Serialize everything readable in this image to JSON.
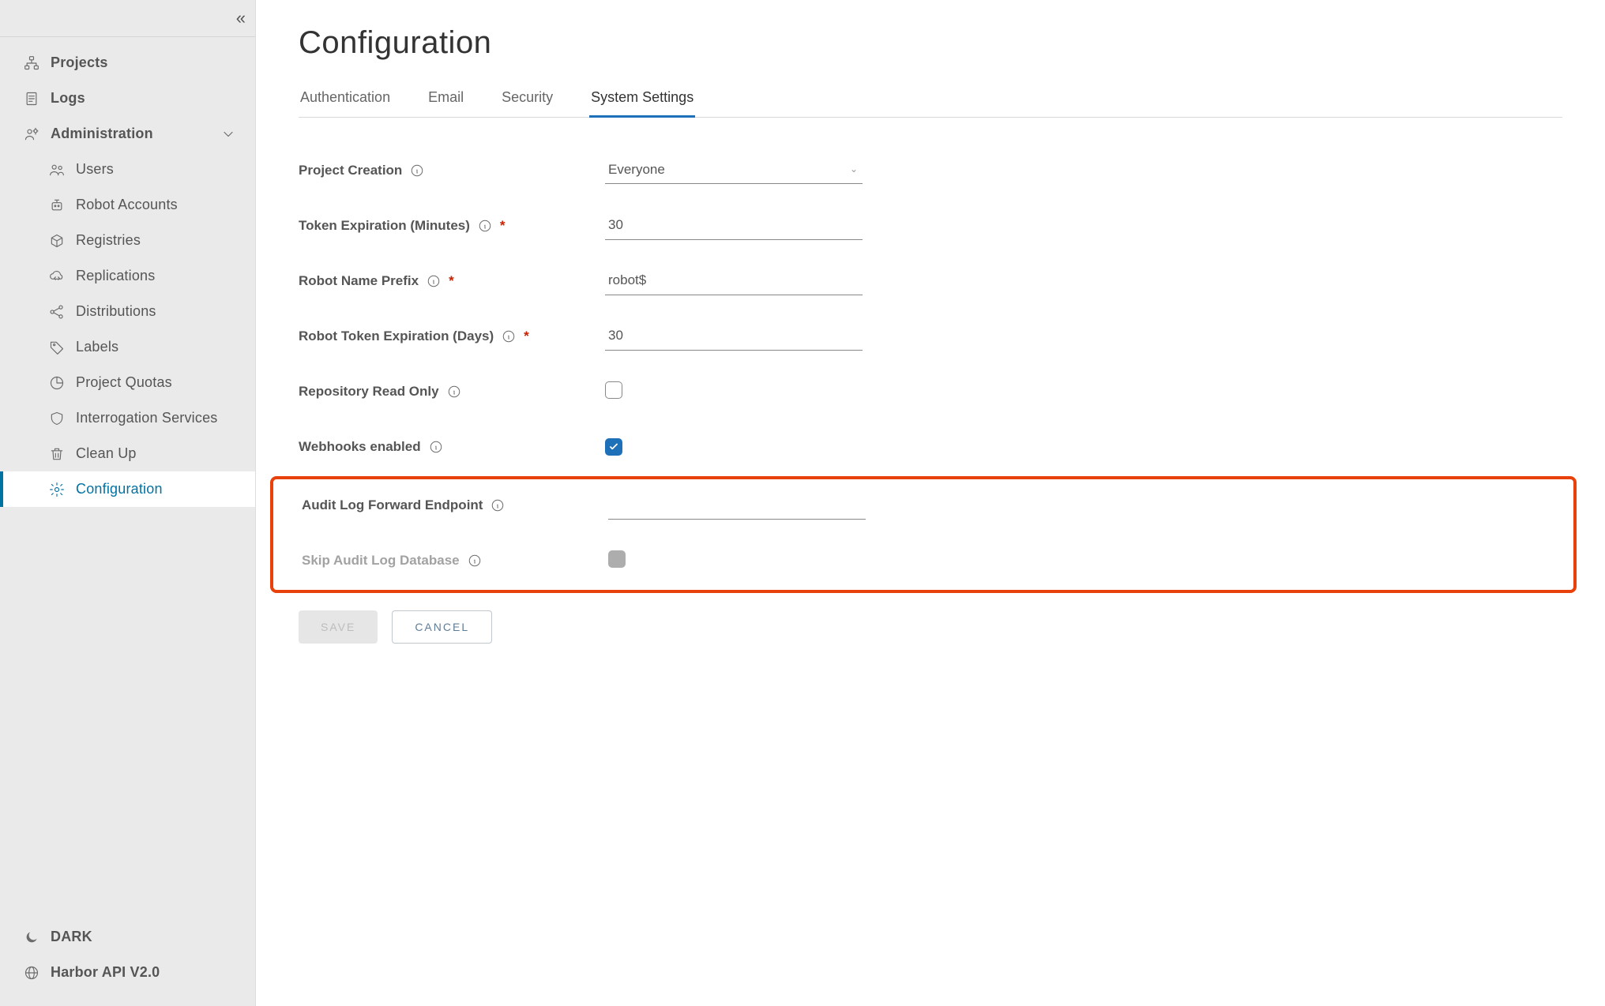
{
  "sidebar": {
    "collapse_glyph": "«",
    "items": [
      {
        "id": "projects",
        "label": "Projects",
        "icon": "sitemap"
      },
      {
        "id": "logs",
        "label": "Logs",
        "icon": "document"
      },
      {
        "id": "administration",
        "label": "Administration",
        "icon": "gear-user",
        "expanded": true,
        "children": [
          {
            "id": "users",
            "label": "Users",
            "icon": "users"
          },
          {
            "id": "robot-accounts",
            "label": "Robot Accounts",
            "icon": "robot"
          },
          {
            "id": "registries",
            "label": "Registries",
            "icon": "cube"
          },
          {
            "id": "replications",
            "label": "Replications",
            "icon": "cloud-sync"
          },
          {
            "id": "distributions",
            "label": "Distributions",
            "icon": "share"
          },
          {
            "id": "labels",
            "label": "Labels",
            "icon": "tag"
          },
          {
            "id": "project-quotas",
            "label": "Project Quotas",
            "icon": "pie"
          },
          {
            "id": "interrogation-services",
            "label": "Interrogation Services",
            "icon": "shield"
          },
          {
            "id": "clean-up",
            "label": "Clean Up",
            "icon": "trash"
          },
          {
            "id": "configuration",
            "label": "Configuration",
            "icon": "gear",
            "active": true
          }
        ]
      }
    ],
    "footer": {
      "theme_label": "DARK",
      "api_label": "Harbor API V2.0"
    }
  },
  "page": {
    "title": "Configuration",
    "tabs": [
      "Authentication",
      "Email",
      "Security",
      "System Settings"
    ],
    "active_tab": "System Settings",
    "fields": {
      "project_creation": {
        "label": "Project Creation",
        "value": "Everyone"
      },
      "token_expiration": {
        "label": "Token Expiration (Minutes)",
        "value": "30",
        "required": true
      },
      "robot_name_prefix": {
        "label": "Robot Name Prefix",
        "value": "robot$",
        "required": true
      },
      "robot_token_expiration": {
        "label": "Robot Token Expiration (Days)",
        "value": "30",
        "required": true
      },
      "repo_read_only": {
        "label": "Repository Read Only",
        "checked": false
      },
      "webhooks_enabled": {
        "label": "Webhooks enabled",
        "checked": true
      },
      "audit_log_forward": {
        "label": "Audit Log Forward Endpoint",
        "value": ""
      },
      "skip_audit_log_db": {
        "label": "Skip Audit Log Database",
        "checked": false,
        "disabled": true
      }
    },
    "actions": {
      "save": "SAVE",
      "cancel": "CANCEL"
    }
  }
}
